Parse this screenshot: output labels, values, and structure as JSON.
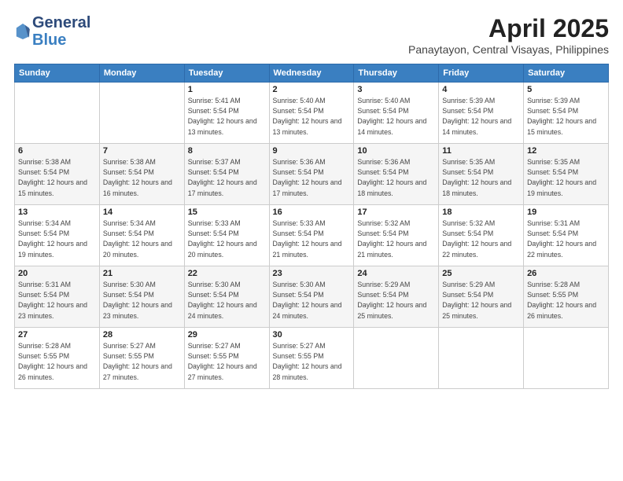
{
  "logo": {
    "general": "General",
    "blue": "Blue"
  },
  "header": {
    "month": "April 2025",
    "location": "Panaytayon, Central Visayas, Philippines"
  },
  "weekdays": [
    "Sunday",
    "Monday",
    "Tuesday",
    "Wednesday",
    "Thursday",
    "Friday",
    "Saturday"
  ],
  "weeks": [
    [
      {
        "day": "",
        "info": ""
      },
      {
        "day": "",
        "info": ""
      },
      {
        "day": "1",
        "info": "Sunrise: 5:41 AM\nSunset: 5:54 PM\nDaylight: 12 hours and 13 minutes."
      },
      {
        "day": "2",
        "info": "Sunrise: 5:40 AM\nSunset: 5:54 PM\nDaylight: 12 hours and 13 minutes."
      },
      {
        "day": "3",
        "info": "Sunrise: 5:40 AM\nSunset: 5:54 PM\nDaylight: 12 hours and 14 minutes."
      },
      {
        "day": "4",
        "info": "Sunrise: 5:39 AM\nSunset: 5:54 PM\nDaylight: 12 hours and 14 minutes."
      },
      {
        "day": "5",
        "info": "Sunrise: 5:39 AM\nSunset: 5:54 PM\nDaylight: 12 hours and 15 minutes."
      }
    ],
    [
      {
        "day": "6",
        "info": "Sunrise: 5:38 AM\nSunset: 5:54 PM\nDaylight: 12 hours and 15 minutes."
      },
      {
        "day": "7",
        "info": "Sunrise: 5:38 AM\nSunset: 5:54 PM\nDaylight: 12 hours and 16 minutes."
      },
      {
        "day": "8",
        "info": "Sunrise: 5:37 AM\nSunset: 5:54 PM\nDaylight: 12 hours and 17 minutes."
      },
      {
        "day": "9",
        "info": "Sunrise: 5:36 AM\nSunset: 5:54 PM\nDaylight: 12 hours and 17 minutes."
      },
      {
        "day": "10",
        "info": "Sunrise: 5:36 AM\nSunset: 5:54 PM\nDaylight: 12 hours and 18 minutes."
      },
      {
        "day": "11",
        "info": "Sunrise: 5:35 AM\nSunset: 5:54 PM\nDaylight: 12 hours and 18 minutes."
      },
      {
        "day": "12",
        "info": "Sunrise: 5:35 AM\nSunset: 5:54 PM\nDaylight: 12 hours and 19 minutes."
      }
    ],
    [
      {
        "day": "13",
        "info": "Sunrise: 5:34 AM\nSunset: 5:54 PM\nDaylight: 12 hours and 19 minutes."
      },
      {
        "day": "14",
        "info": "Sunrise: 5:34 AM\nSunset: 5:54 PM\nDaylight: 12 hours and 20 minutes."
      },
      {
        "day": "15",
        "info": "Sunrise: 5:33 AM\nSunset: 5:54 PM\nDaylight: 12 hours and 20 minutes."
      },
      {
        "day": "16",
        "info": "Sunrise: 5:33 AM\nSunset: 5:54 PM\nDaylight: 12 hours and 21 minutes."
      },
      {
        "day": "17",
        "info": "Sunrise: 5:32 AM\nSunset: 5:54 PM\nDaylight: 12 hours and 21 minutes."
      },
      {
        "day": "18",
        "info": "Sunrise: 5:32 AM\nSunset: 5:54 PM\nDaylight: 12 hours and 22 minutes."
      },
      {
        "day": "19",
        "info": "Sunrise: 5:31 AM\nSunset: 5:54 PM\nDaylight: 12 hours and 22 minutes."
      }
    ],
    [
      {
        "day": "20",
        "info": "Sunrise: 5:31 AM\nSunset: 5:54 PM\nDaylight: 12 hours and 23 minutes."
      },
      {
        "day": "21",
        "info": "Sunrise: 5:30 AM\nSunset: 5:54 PM\nDaylight: 12 hours and 23 minutes."
      },
      {
        "day": "22",
        "info": "Sunrise: 5:30 AM\nSunset: 5:54 PM\nDaylight: 12 hours and 24 minutes."
      },
      {
        "day": "23",
        "info": "Sunrise: 5:30 AM\nSunset: 5:54 PM\nDaylight: 12 hours and 24 minutes."
      },
      {
        "day": "24",
        "info": "Sunrise: 5:29 AM\nSunset: 5:54 PM\nDaylight: 12 hours and 25 minutes."
      },
      {
        "day": "25",
        "info": "Sunrise: 5:29 AM\nSunset: 5:54 PM\nDaylight: 12 hours and 25 minutes."
      },
      {
        "day": "26",
        "info": "Sunrise: 5:28 AM\nSunset: 5:55 PM\nDaylight: 12 hours and 26 minutes."
      }
    ],
    [
      {
        "day": "27",
        "info": "Sunrise: 5:28 AM\nSunset: 5:55 PM\nDaylight: 12 hours and 26 minutes."
      },
      {
        "day": "28",
        "info": "Sunrise: 5:27 AM\nSunset: 5:55 PM\nDaylight: 12 hours and 27 minutes."
      },
      {
        "day": "29",
        "info": "Sunrise: 5:27 AM\nSunset: 5:55 PM\nDaylight: 12 hours and 27 minutes."
      },
      {
        "day": "30",
        "info": "Sunrise: 5:27 AM\nSunset: 5:55 PM\nDaylight: 12 hours and 28 minutes."
      },
      {
        "day": "",
        "info": ""
      },
      {
        "day": "",
        "info": ""
      },
      {
        "day": "",
        "info": ""
      }
    ]
  ]
}
